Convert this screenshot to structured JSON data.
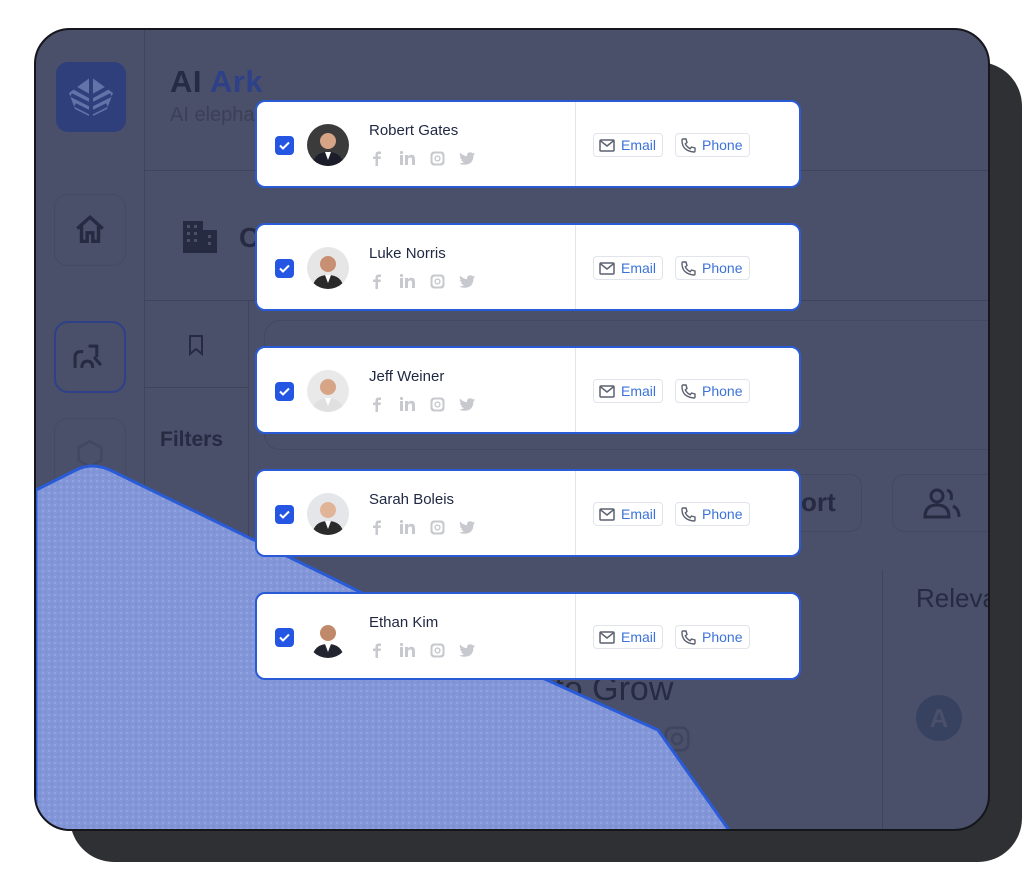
{
  "app": {
    "brand_name_part1": "AI",
    "brand_name_part2": "Ark",
    "brand_subtitle": "AI elepha",
    "brand_color": "#2e4188"
  },
  "background_ui": {
    "nav_items": [
      {
        "name": "home",
        "icon": "home-icon"
      },
      {
        "name": "people-search",
        "icon": "people-search-icon",
        "active": true
      },
      {
        "name": "hexagon",
        "icon": "hexagon-icon"
      }
    ],
    "section_title_partial": "C",
    "filters_label": "Filters",
    "export_label_partial": "ort",
    "people_label_partial": "P",
    "relevance_label_partial": "Releva",
    "headline_partial": "d to Grow",
    "avatar_initial": "A"
  },
  "contacts": [
    {
      "name": "Robert Gates",
      "checked": true,
      "email_label": "Email",
      "phone_label": "Phone"
    },
    {
      "name": "Luke Norris",
      "checked": true,
      "email_label": "Email",
      "phone_label": "Phone"
    },
    {
      "name": "Jeff Weiner",
      "checked": true,
      "email_label": "Email",
      "phone_label": "Phone"
    },
    {
      "name": "Sarah Boleis",
      "checked": true,
      "email_label": "Email",
      "phone_label": "Phone"
    },
    {
      "name": "Ethan Kim",
      "checked": true,
      "email_label": "Email",
      "phone_label": "Phone"
    }
  ],
  "social_icons": [
    "facebook-icon",
    "linkedin-icon",
    "instagram-icon",
    "twitter-icon"
  ],
  "colors": {
    "accent": "#2456e3",
    "link": "#3b72d9",
    "overlay": "#4a4f6a",
    "blob": "#8296d8"
  }
}
